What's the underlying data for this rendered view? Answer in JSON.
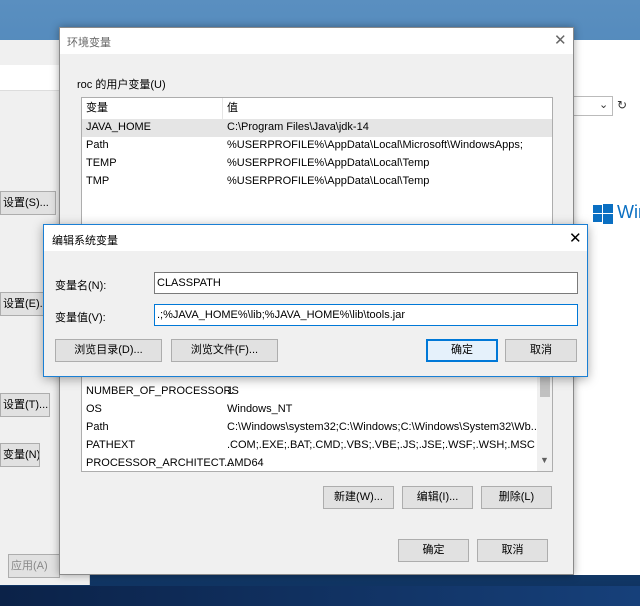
{
  "background_left": {
    "buttons": [
      "设置(S)...",
      "设置(E)...",
      "设置(T)...",
      "变量(N)...",
      "应用(A)"
    ]
  },
  "background_right": {
    "brand_text": "Win"
  },
  "env_window": {
    "title": "环境变量",
    "user_group_title": "roc 的用户变量(U)",
    "columns": [
      "变量",
      "值"
    ],
    "user_vars": [
      {
        "name": "JAVA_HOME",
        "value": "C:\\Program Files\\Java\\jdk-14"
      },
      {
        "name": "Path",
        "value": "%USERPROFILE%\\AppData\\Local\\Microsoft\\WindowsApps;"
      },
      {
        "name": "TEMP",
        "value": "%USERPROFILE%\\AppData\\Local\\Temp"
      },
      {
        "name": "TMP",
        "value": "%USERPROFILE%\\AppData\\Local\\Temp"
      }
    ],
    "system_vars": [
      {
        "name": "NUMBER_OF_PROCESSORS",
        "value": "1"
      },
      {
        "name": "OS",
        "value": "Windows_NT"
      },
      {
        "name": "Path",
        "value": "C:\\Windows\\system32;C:\\Windows;C:\\Windows\\System32\\Wb..."
      },
      {
        "name": "PATHEXT",
        "value": ".COM;.EXE;.BAT;.CMD;.VBS;.VBE;.JS;.JSE;.WSF;.WSH;.MSC"
      },
      {
        "name": "PROCESSOR_ARCHITECT...",
        "value": "AMD64"
      }
    ],
    "buttons": {
      "new": "新建(W)...",
      "edit": "编辑(I)...",
      "delete": "删除(L)",
      "ok": "确定",
      "cancel": "取消"
    }
  },
  "edit_dialog": {
    "title": "编辑系统变量",
    "name_label": "变量名(N):",
    "name_value": "CLASSPATH",
    "value_label": "变量值(V):",
    "value_value": ".;%JAVA_HOME%\\lib;%JAVA_HOME%\\lib\\tools.jar",
    "buttons": {
      "browse_dir": "浏览目录(D)...",
      "browse_file": "浏览文件(F)...",
      "ok": "确定",
      "cancel": "取消"
    }
  },
  "colors": {
    "accent": "#0078d7",
    "selection": "#e5e5e5",
    "dialog_bg": "#f0f0f0"
  },
  "icons": {
    "close": "close-icon",
    "refresh": "refresh-icon",
    "dropdown": "chevron-down-icon",
    "windows_logo": "windows-logo-icon"
  }
}
